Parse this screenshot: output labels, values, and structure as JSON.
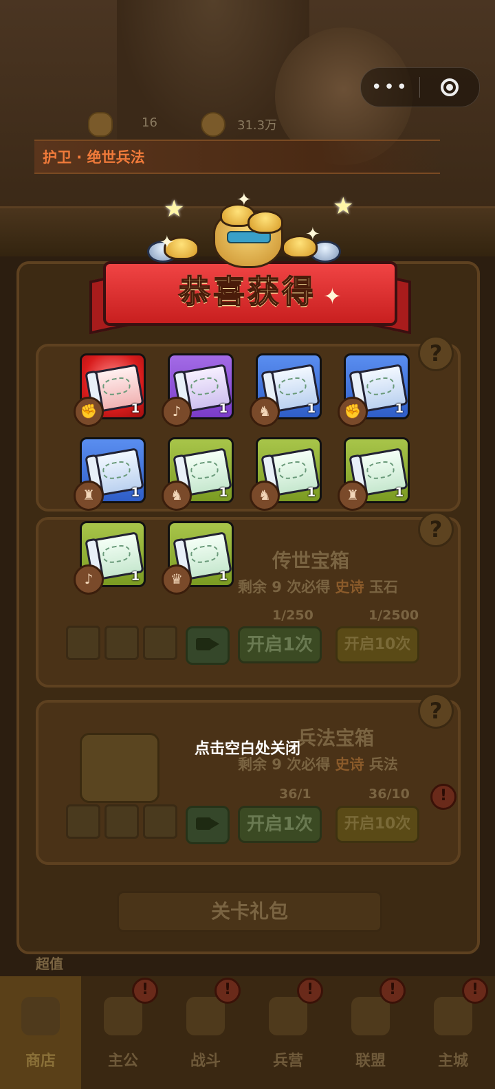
{
  "header": {
    "resources": [
      {
        "icon": "gold-ingot-icon",
        "value": "16"
      },
      {
        "icon": "coin-icon",
        "value": "31.3万"
      }
    ],
    "title": "护卫 · 绝世兵法"
  },
  "mini_program_capsule": {
    "menu_icon": "more-dots-icon",
    "close_icon": "target-circle-icon"
  },
  "reward_popup": {
    "title": "恭喜获得",
    "items": [
      {
        "rarity": "red",
        "badge": "sword-hand-badge-icon",
        "count": "1"
      },
      {
        "rarity": "purple",
        "badge": "horn-badge-icon",
        "count": "1"
      },
      {
        "rarity": "blue",
        "badge": "horse-badge-icon",
        "count": "1"
      },
      {
        "rarity": "blue",
        "badge": "sword-hand-badge-icon",
        "count": "1"
      },
      {
        "rarity": "blue",
        "badge": "dragon-badge-icon",
        "count": "1"
      },
      {
        "rarity": "green",
        "badge": "horse-badge-icon",
        "count": "1"
      },
      {
        "rarity": "green",
        "badge": "horse-badge-icon",
        "count": "1"
      },
      {
        "rarity": "green",
        "badge": "dragon-badge-icon",
        "count": "1"
      },
      {
        "rarity": "green",
        "badge": "horn-badge-icon",
        "count": "1"
      },
      {
        "rarity": "green",
        "badge": "tiger-badge-icon",
        "count": "1"
      }
    ],
    "close_hint": "点击空白处关闭"
  },
  "shop": {
    "legend_chest": {
      "title": "传世宝箱",
      "subtitle_prefix": "剩余 9 次必得",
      "subtitle_highlight": "史诗",
      "subtitle_suffix": "玉石",
      "cost_one": "1/250",
      "cost_ten": "1/2500",
      "btn_one": "开启1次",
      "btn_ten": "开启10次"
    },
    "tactics_chest": {
      "title": "兵法宝箱",
      "subtitle_prefix": "剩余 9 次必得",
      "subtitle_highlight": "史诗",
      "subtitle_suffix": "兵法",
      "key_one": "36/1",
      "key_ten": "36/10",
      "btn_one": "开启1次",
      "btn_ten": "开启10次"
    },
    "stage_gift": "关卡礼包",
    "value_label": "超值"
  },
  "bottom_nav": [
    {
      "label": "商店",
      "icon": "shop-icon",
      "active": true,
      "alert": false
    },
    {
      "label": "主公",
      "icon": "lord-icon",
      "active": false,
      "alert": true
    },
    {
      "label": "战斗",
      "icon": "crossed-swords-icon",
      "active": false,
      "alert": true
    },
    {
      "label": "兵营",
      "icon": "barracks-flag-icon",
      "active": false,
      "alert": true
    },
    {
      "label": "联盟",
      "icon": "alliance-banner-icon",
      "active": false,
      "alert": true
    },
    {
      "label": "主城",
      "icon": "city-map-icon",
      "active": false,
      "alert": true
    }
  ],
  "colors": {
    "title_text": "#f07a3a",
    "ribbon": "#d82a2a",
    "overlay": "rgba(20,12,4,0.55)"
  }
}
